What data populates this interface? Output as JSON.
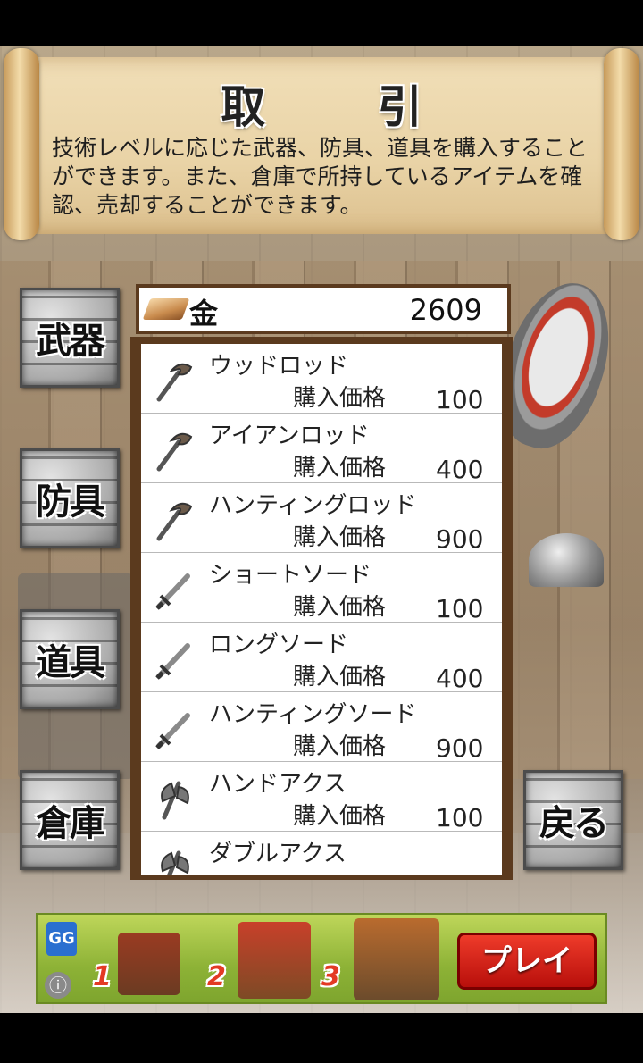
{
  "banner": {
    "title": "取 引",
    "description": "技術レベルに応じた武器、防具、道具を購入することができます。また、倉庫で所持しているアイテムを確認、売却することができます。"
  },
  "menu": {
    "weapons": "武器",
    "armor": "防具",
    "tools": "道具",
    "warehouse": "倉庫",
    "back": "戻る"
  },
  "money": {
    "label": "金",
    "amount": "2609"
  },
  "items": [
    {
      "name": "ウッドロッド",
      "price_label": "購入価格",
      "price": "100",
      "icon": "rod-icon"
    },
    {
      "name": "アイアンロッド",
      "price_label": "購入価格",
      "price": "400",
      "icon": "rod-icon"
    },
    {
      "name": "ハンティングロッド",
      "price_label": "購入価格",
      "price": "900",
      "icon": "rod-icon"
    },
    {
      "name": "ショートソード",
      "price_label": "購入価格",
      "price": "100",
      "icon": "sword-icon"
    },
    {
      "name": "ロングソード",
      "price_label": "購入価格",
      "price": "400",
      "icon": "sword-icon"
    },
    {
      "name": "ハンティングソード",
      "price_label": "購入価格",
      "price": "900",
      "icon": "sword-icon"
    },
    {
      "name": "ハンドアクス",
      "price_label": "購入価格",
      "price": "100",
      "icon": "axe-icon"
    },
    {
      "name": "ダブルアクス",
      "price_label": "",
      "price": "",
      "icon": "axe-icon"
    }
  ],
  "ad": {
    "logo": "GG",
    "numbers": [
      "1",
      "2",
      "3"
    ],
    "play_label": "プレイ",
    "info_icon": "info-icon"
  }
}
